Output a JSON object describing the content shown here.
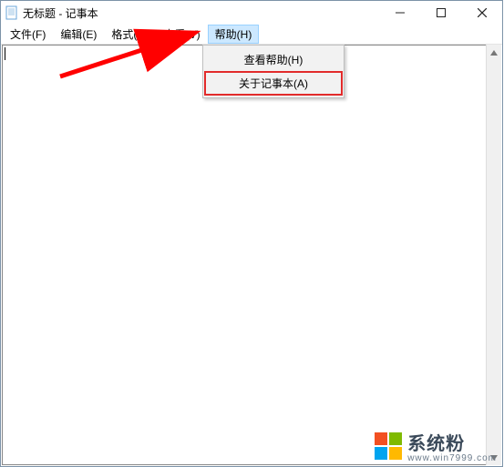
{
  "window": {
    "title": "无标题 - 记事本"
  },
  "menus": {
    "file": "文件(F)",
    "edit": "编辑(E)",
    "format": "格式(O)",
    "view": "查看(V)",
    "help": "帮助(H)"
  },
  "help_menu": {
    "view_help": "查看帮助(H)",
    "about": "关于记事本(A)"
  },
  "watermark": {
    "text": "系统粉",
    "url": "www.win7999.com",
    "colors": {
      "tl": "#f25022",
      "tr": "#7fba00",
      "bl": "#00a4ef",
      "br": "#ffb900"
    }
  },
  "annotation": {
    "arrow_color": "#ff0000",
    "highlight_color": "#e22b2b"
  }
}
